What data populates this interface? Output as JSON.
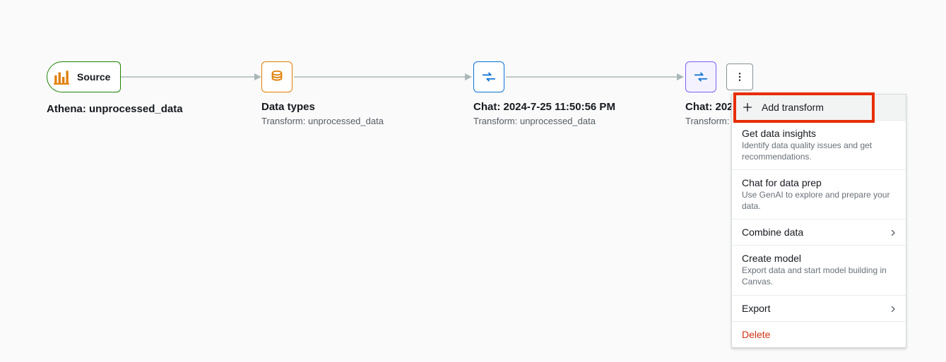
{
  "source": {
    "pill_label": "Source",
    "title": "Athena: unprocessed_data"
  },
  "nodes": [
    {
      "title": "Data types",
      "subtitle": "Transform: unprocessed_data"
    },
    {
      "title": "Chat: 2024-7-25 11:50:56 PM",
      "subtitle": "Transform: unprocessed_data"
    },
    {
      "title": "Chat: 202",
      "subtitle": "Transform:"
    }
  ],
  "menu": {
    "add_transform": "Add transform",
    "get_insights": {
      "label": "Get data insights",
      "desc": "Identify data quality issues and get recommendations."
    },
    "chat_prep": {
      "label": "Chat for data prep",
      "desc": "Use GenAI to explore and prepare your data."
    },
    "combine": {
      "label": "Combine data"
    },
    "create_model": {
      "label": "Create model",
      "desc": "Export data and start model building in Canvas."
    },
    "export": {
      "label": "Export"
    },
    "delete": {
      "label": "Delete"
    }
  }
}
